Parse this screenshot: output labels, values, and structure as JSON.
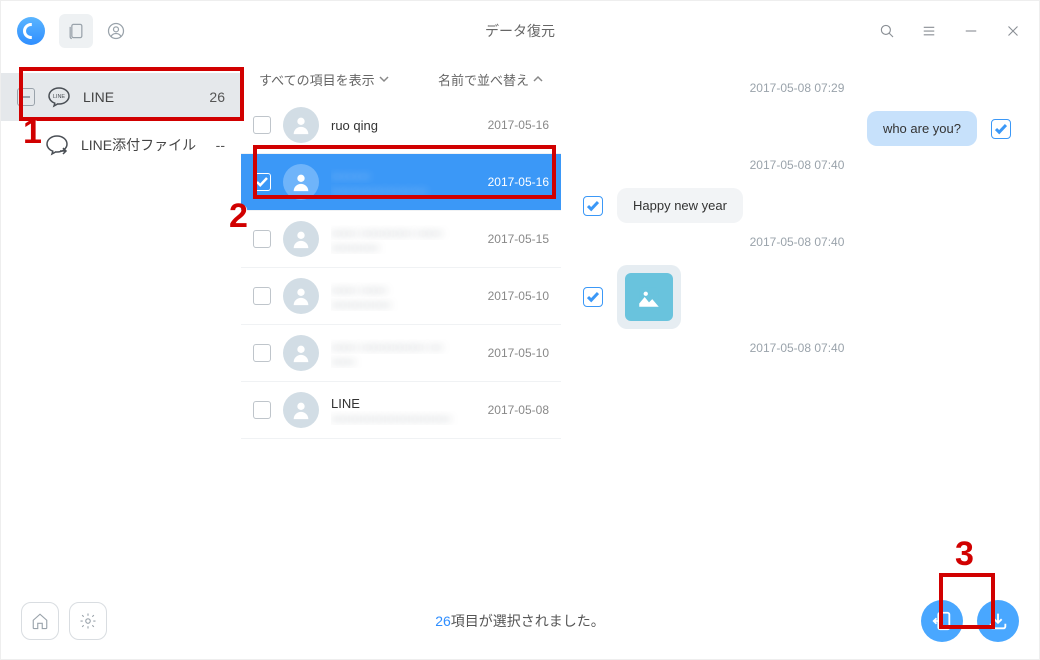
{
  "title": "データ復元",
  "sidebar": {
    "items": [
      {
        "label": "LINE",
        "count": "26"
      },
      {
        "label": "LINE添付ファイル",
        "count": "--"
      }
    ]
  },
  "listHead": {
    "filter": "すべての項目を表示",
    "sort": "名前で並べ替え"
  },
  "conversations": [
    {
      "name": "ruo qing",
      "sub": "",
      "date": "2017-05-16",
      "blurName": false,
      "blurSub": false,
      "selected": false
    },
    {
      "name": "———",
      "sub": "————————",
      "date": "2017-05-16",
      "blurName": true,
      "blurSub": true,
      "selected": true
    },
    {
      "name": "—— ———— ——",
      "sub": "————",
      "date": "2017-05-15",
      "blurName": true,
      "blurSub": true,
      "selected": false
    },
    {
      "name": "—— ——",
      "sub": "—————",
      "date": "2017-05-10",
      "blurName": true,
      "blurSub": true,
      "selected": false
    },
    {
      "name": "—— ————— —",
      "sub": "——",
      "date": "2017-05-10",
      "blurName": true,
      "blurSub": true,
      "selected": false
    },
    {
      "name": "LINE",
      "sub": "——————————",
      "date": "2017-05-08",
      "blurName": false,
      "blurSub": true,
      "selected": false
    }
  ],
  "chat": {
    "ts1": "2017-05-08 07:29",
    "m1": "who are you?",
    "ts2": "2017-05-08 07:40",
    "m2": "Happy new year",
    "ts3": "2017-05-08 07:40",
    "ts4": "2017-05-08 07:40"
  },
  "footer": {
    "count": "26",
    "suffix": "項目が選択されました。"
  },
  "ann": {
    "n1": "1",
    "n2": "2",
    "n3": "3"
  }
}
